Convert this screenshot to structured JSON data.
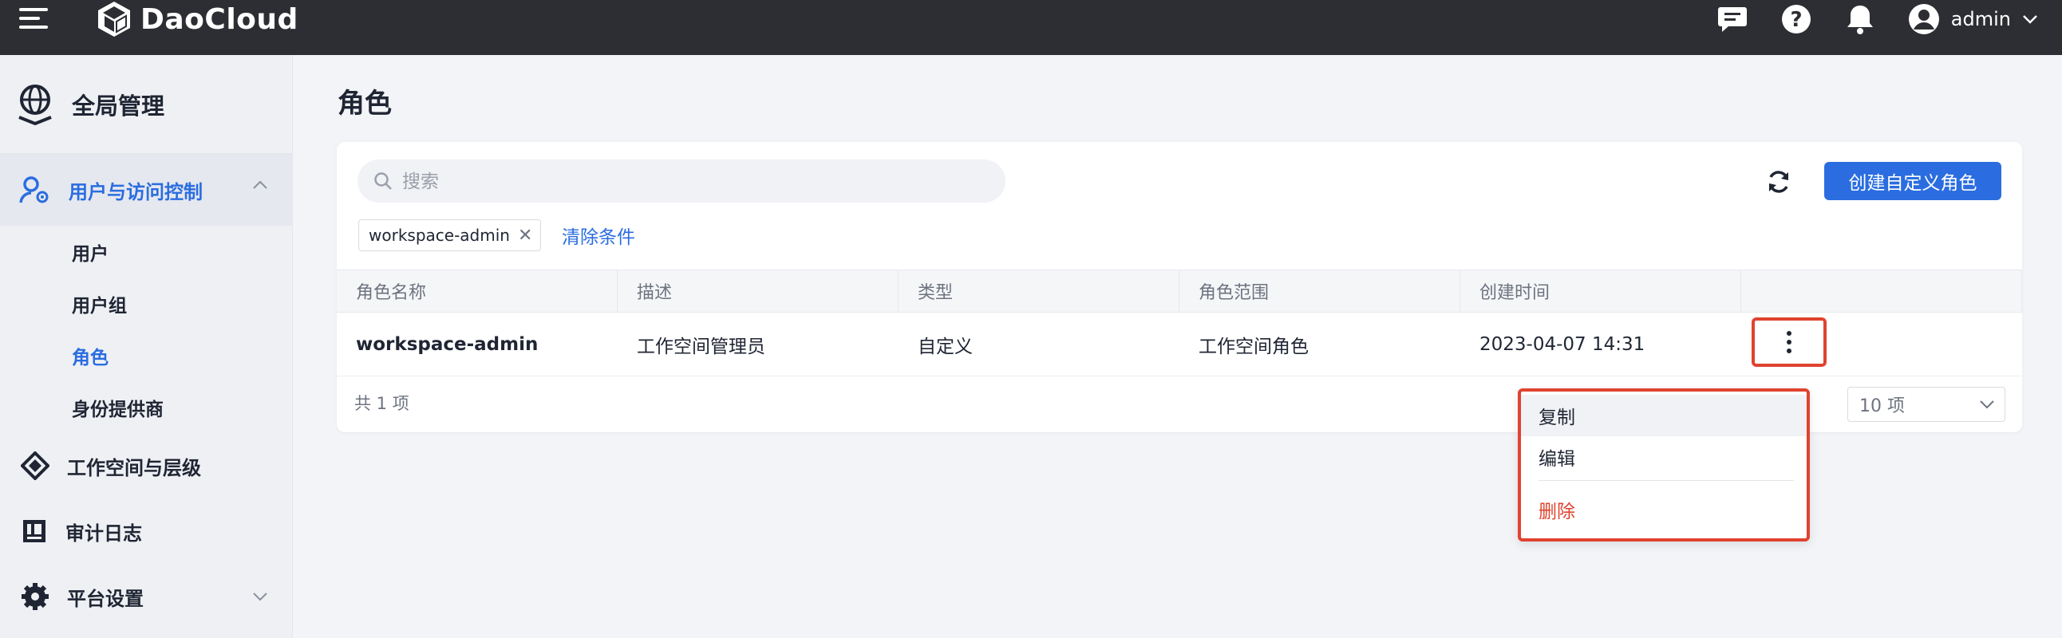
{
  "topbar": {
    "brand": "DaoCloud",
    "user_name": "admin",
    "icons": [
      "menu-icon",
      "chat-icon",
      "help-icon",
      "bell-icon",
      "user-avatar-icon",
      "chevron-down-icon"
    ]
  },
  "sidebar": {
    "title": "全局管理",
    "group": {
      "label": "用户与访问控制",
      "expanded": true
    },
    "subitems": [
      {
        "label": "用户",
        "active": false
      },
      {
        "label": "用户组",
        "active": false
      },
      {
        "label": "角色",
        "active": true
      },
      {
        "label": "身份提供商",
        "active": false
      }
    ],
    "items": [
      {
        "label": "工作空间与层级",
        "icon": "workspace-icon"
      },
      {
        "label": "审计日志",
        "icon": "audit-log-icon"
      },
      {
        "label": "平台设置",
        "icon": "settings-gear-icon"
      }
    ]
  },
  "page": {
    "title": "角色",
    "search_placeholder": "搜索",
    "create_button": "创建自定义角色",
    "filter_chip": "workspace-admin",
    "clear_filters": "清除条件",
    "total": "共 1 项",
    "page_size": "10 项"
  },
  "table": {
    "headers": [
      "角色名称",
      "描述",
      "类型",
      "角色范围",
      "创建时间"
    ],
    "rows": [
      {
        "name": "workspace-admin",
        "description": "工作空间管理员",
        "type": "自定义",
        "scope": "工作空间角色",
        "created": "2023-04-07 14:31"
      }
    ]
  },
  "context_menu": {
    "items": [
      {
        "label": "复制",
        "style": "hover"
      },
      {
        "label": "编辑",
        "style": "normal"
      },
      {
        "label": "删除",
        "style": "danger"
      }
    ]
  },
  "colors": {
    "accent": "#2b6de0",
    "danger": "#e0432f",
    "topbar_bg": "#2c2e33",
    "highlight_box": "#e0432f"
  }
}
